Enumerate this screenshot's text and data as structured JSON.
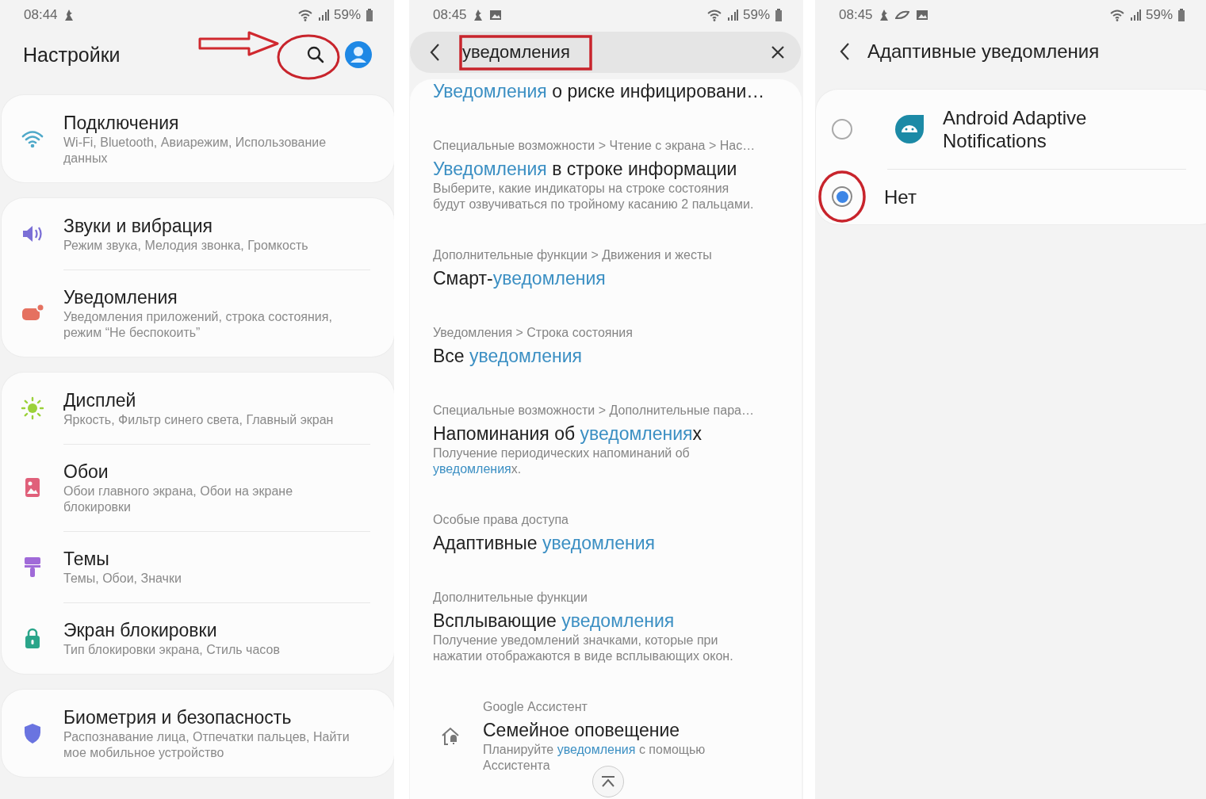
{
  "settings_screen": {
    "status": {
      "time": "08:44",
      "battery": "59%"
    },
    "title": "Настройки",
    "groups": [
      {
        "items": [
          {
            "title": "Подключения",
            "subtitle": "Wi-Fi, Bluetooth, Авиарежим, Использование данных"
          }
        ]
      },
      {
        "items": [
          {
            "title": "Звуки и вибрация",
            "subtitle": "Режим звука, Мелодия звонка, Громкость"
          },
          {
            "title": "Уведомления",
            "subtitle": "Уведомления приложений, строка состояния, режим “Не беспокоить”"
          }
        ]
      },
      {
        "items": [
          {
            "title": "Дисплей",
            "subtitle": "Яркость, Фильтр синего света, Главный экран"
          },
          {
            "title": "Обои",
            "subtitle": "Обои главного экрана, Обои на экране блокировки"
          },
          {
            "title": "Темы",
            "subtitle": "Темы, Обои, Значки"
          },
          {
            "title": "Экран блокировки",
            "subtitle": "Тип блокировки экрана, Стиль часов"
          }
        ]
      },
      {
        "items": [
          {
            "title": "Биометрия и безопасность",
            "subtitle": "Распознавание лица, Отпечатки пальцев, Найти мое мобильное устройство"
          }
        ]
      }
    ]
  },
  "search_screen": {
    "status": {
      "time": "08:45",
      "battery": "59%"
    },
    "query": "уведомления",
    "results": [
      {
        "kind": "plain",
        "title": "**Уведомления** о риске инфицировани…"
      },
      {
        "kind": "plain",
        "path": "Специальные возможности > Чтение с экрана > Нас…",
        "title": "**Уведомления** в строке информации",
        "description": "Выберите, какие индикаторы на строке состояния будут озвучиваться по тройному касанию 2 пальцами."
      },
      {
        "kind": "plain",
        "path": "Дополнительные функции > Движения и жесты",
        "title": "Смарт-**уведомления**"
      },
      {
        "kind": "plain",
        "path": "Уведомления > Строка состояния",
        "title": "Все **уведомления**"
      },
      {
        "kind": "plain",
        "path": "Специальные возможности > Дополнительные пара…",
        "title": "Напоминания об **уведомления**х",
        "description": "Получение периодических напоминаний об **уведомления**х."
      },
      {
        "kind": "plain",
        "path": "Особые права доступа",
        "title": "Адаптивные **уведомления**"
      },
      {
        "kind": "plain",
        "path": "Дополнительные функции",
        "title": "Всплывающие **уведомления**",
        "description": "Получение уведомлений значками, которые при нажатии отображаются в виде всплывающих окон."
      },
      {
        "kind": "with_icon",
        "path": "Google Ассистент",
        "title": "Семейное оповещение",
        "description": "Планируйте **уведомления** с помощью Ассистента"
      }
    ]
  },
  "adaptive_screen": {
    "status": {
      "time": "08:45",
      "battery": "59%"
    },
    "title": "Адаптивные уведомления",
    "options": [
      {
        "kind": "app",
        "label": "Android Adaptive Notifications",
        "selected": false
      },
      {
        "kind": "plain",
        "label": "Нет",
        "selected": true
      }
    ]
  }
}
